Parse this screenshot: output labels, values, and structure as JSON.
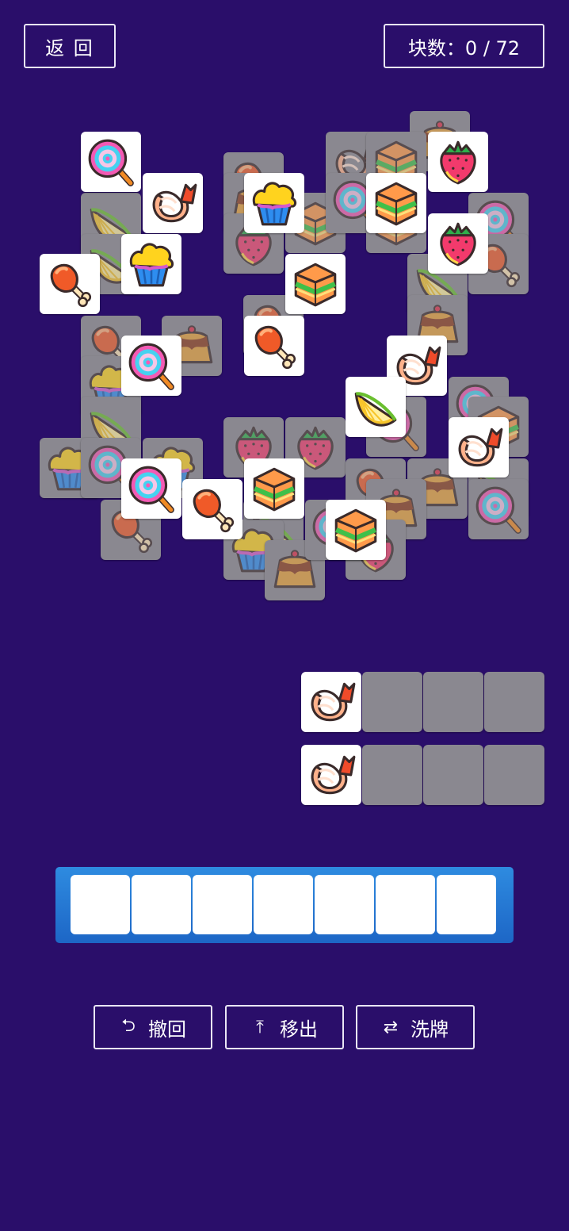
{
  "header": {
    "back_label": "返 回",
    "count_label": "块数：0 / 72"
  },
  "tools": [
    {
      "label": "撤回",
      "icon": "undo-icon",
      "glyph": "⮌"
    },
    {
      "label": "移出",
      "icon": "move-out-icon",
      "glyph": "⤒"
    },
    {
      "label": "洗牌",
      "icon": "shuffle-icon",
      "glyph": "⇄"
    }
  ],
  "tray": {
    "capacity": 7,
    "items": []
  },
  "side_stacks": [
    {
      "top": "shrimp",
      "empty_slots": 3
    },
    {
      "top": "shrimp",
      "empty_slots": 3
    }
  ],
  "board": {
    "tile_types": [
      "lollipop",
      "shrimp",
      "cupcake",
      "cake",
      "strawberry",
      "drumstick",
      "lemon",
      "pudding"
    ],
    "tiles_remaining": 72
  }
}
